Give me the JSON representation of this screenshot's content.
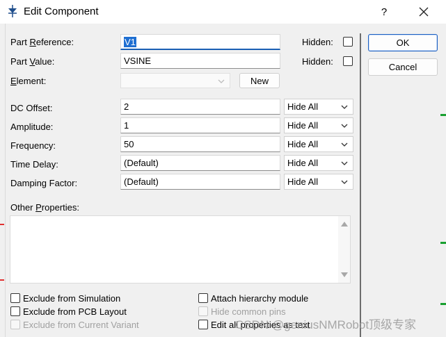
{
  "window": {
    "title": "Edit Component",
    "help": "?",
    "close_icon": "close-icon"
  },
  "fields": {
    "part_reference": {
      "label_pre": "Part ",
      "label_u": "R",
      "label_post": "eference:",
      "value": "V1",
      "hidden_label": "Hidden:",
      "hidden": false
    },
    "part_value": {
      "label_pre": "Part ",
      "label_u": "V",
      "label_post": "alue:",
      "value": "VSINE",
      "hidden_label": "Hidden:",
      "hidden": false
    },
    "element": {
      "label_pre": "",
      "label_u": "E",
      "label_post": "lement:",
      "value": "",
      "new_button": "New"
    }
  },
  "properties": [
    {
      "label": "DC Offset:",
      "value": "2",
      "visibility": "Hide All"
    },
    {
      "label": "Amplitude:",
      "value": "1",
      "visibility": "Hide All"
    },
    {
      "label": "Frequency:",
      "value": "50",
      "visibility": "Hide All"
    },
    {
      "label": "Time Delay:",
      "value": "(Default)",
      "visibility": "Hide All"
    },
    {
      "label": "Damping Factor:",
      "value": "(Default)",
      "visibility": "Hide All"
    }
  ],
  "other_properties": {
    "label_pre": "Other ",
    "label_u": "P",
    "label_post": "roperties:",
    "value": ""
  },
  "options_left": [
    {
      "label": "Exclude from Simulation",
      "checked": false,
      "enabled": true
    },
    {
      "label": "Exclude from PCB Layout",
      "checked": false,
      "enabled": true
    },
    {
      "label": "Exclude from Current Variant",
      "checked": false,
      "enabled": false
    }
  ],
  "options_right": [
    {
      "label": "Attach hierarchy module",
      "checked": false,
      "enabled": true
    },
    {
      "label": "Hide common pins",
      "checked": false,
      "enabled": false
    },
    {
      "label": "Edit all properties as text",
      "checked": false,
      "enabled": true
    }
  ],
  "buttons": {
    "ok": "OK",
    "cancel": "Cancel"
  },
  "watermark": "CSDN @geniusNMRobot顶级专家",
  "colors": {
    "accent": "#1a5fb4",
    "selection": "#1f6fd2",
    "disabled_text": "#a0a0a0"
  }
}
